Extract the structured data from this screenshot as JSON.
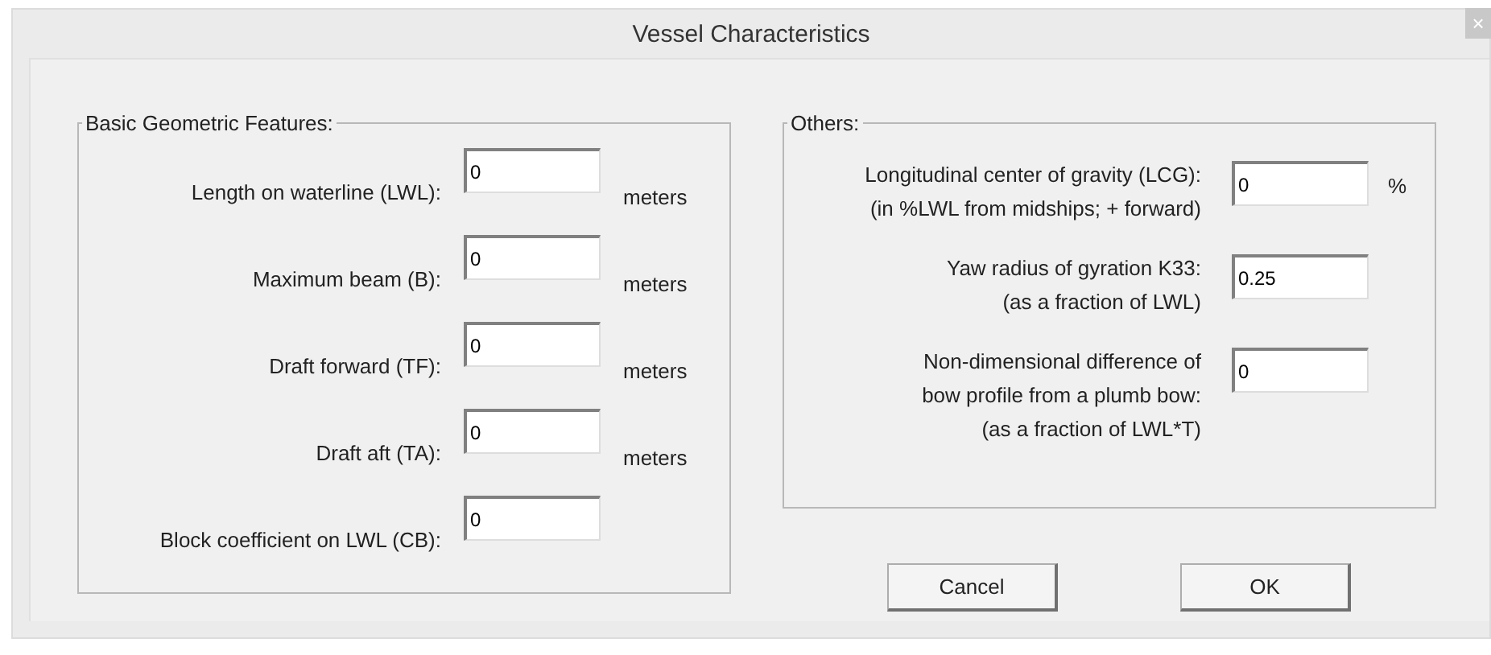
{
  "window": {
    "title": "Vessel Characteristics",
    "close": "×"
  },
  "basic": {
    "title": "Basic Geometric Features:",
    "fields": [
      {
        "label": "Length on waterline (LWL):",
        "value": "0",
        "unit": "meters"
      },
      {
        "label": "Maximum beam (B):",
        "value": "0",
        "unit": "meters"
      },
      {
        "label": "Draft forward (TF):",
        "value": "0",
        "unit": "meters"
      },
      {
        "label": "Draft aft (TA):",
        "value": "0",
        "unit": "meters"
      },
      {
        "label": "Block coefficient on LWL (CB):",
        "value": "0"
      }
    ]
  },
  "others": {
    "title": "Others:",
    "fields": [
      {
        "label_lines": [
          "Longitudinal center of gravity (LCG):",
          "(in %LWL from midships; + forward)"
        ],
        "value": "0",
        "unit": "%"
      },
      {
        "label_lines": [
          "Yaw radius of gyration K33:",
          "(as a fraction of LWL)"
        ],
        "value": "0.25"
      },
      {
        "label_lines": [
          "Non-dimensional difference of",
          "bow profile from a plumb bow:",
          "(as a fraction of LWL*T)"
        ],
        "value": "0"
      }
    ]
  },
  "buttons": [
    "Cancel",
    "OK"
  ]
}
